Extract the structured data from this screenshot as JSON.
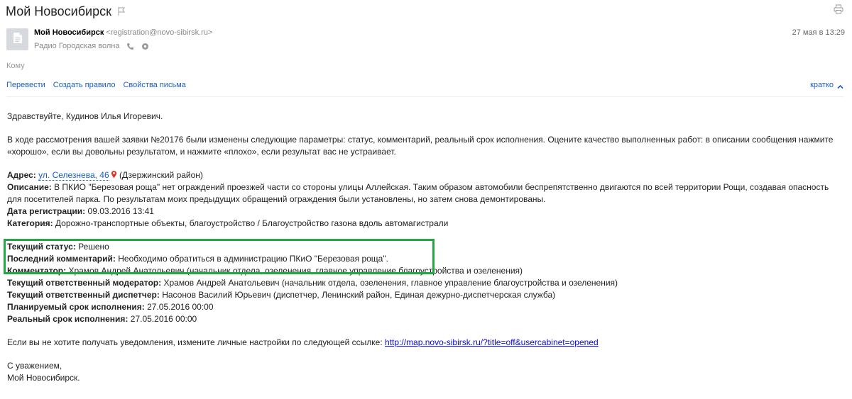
{
  "header": {
    "subject": "Мой Новосибирск"
  },
  "sender": {
    "name": "Мой Новосибирск",
    "email": "<registration@novo-sibirsk.ru>",
    "date": "27 мая в 13:29",
    "recipient": "Радио Городская волна"
  },
  "to_label": "Кому",
  "actions": {
    "translate": "Перевести",
    "create_rule": "Создать правило",
    "properties": "Свойства письма",
    "short": "кратко"
  },
  "body": {
    "greeting": "Здравствуйте, Кудинов Илья Игоревич.",
    "intro": "В ходе рассмотрения вашей заявки №20176 были изменены следующие параметры: статус, комментарий, реальный срок исполнения. Оцените качество выполненных работ: в описании сообщения нажмите «хорошо», если вы довольны результатом, и нажмите «плохо», если результат вас не устраивает.",
    "address_label": "Адрес:",
    "address_link": "ул. Селезнева, 46",
    "address_district": "(Дзержинский район)",
    "description_label": "Описание:",
    "description": "В ПКИО \"Березовая роща\" нет ограждений проезжей части со стороны улицы Аллейская. Таким образом автомобили беспрепятственно двигаются по всей территории Рощи, создавая опасность для посетителей парка. По результатам моих предыдущих обращений ограждения были установлены, но затем снова демонтированы.",
    "reg_date_label": "Дата регистрации:",
    "reg_date": "09.03.2016 13:41",
    "category_label": "Категория:",
    "category": "Дорожно-транспортные объекты, благоустройство / Благоустройство газона вдоль автомагистрали",
    "status_label": "Текущий статус:",
    "status": "Решено",
    "last_comment_label": "Последний комментарий:",
    "last_comment": "Необходимо обратиться в администрацию ПКиО \"Березовая роща\".",
    "commentator_label": "Комментатор:",
    "commentator": "Храмов Андрей Анатольевич (начальник отдела, озеленения, главное управление благоустройства и озеленения)",
    "moderator_label": "Текущий ответственный модератор:",
    "moderator": "Храмов Андрей Анатольевич (начальник отдела, озеленения, главное управление благоустройства и озеленения)",
    "dispatcher_label": "Текущий ответственный диспетчер:",
    "dispatcher": "Насонов Василий Юрьевич (диспетчер, Ленинский район, Единая дежурно-диспетчерская служба)",
    "planned_label": "Планируемый срок исполнения:",
    "planned": "27.05.2016 00:00",
    "real_label": "Реальный срок исполнения:",
    "real": "27.05.2016 00:00",
    "unsubscribe_text": "Если вы не хотите получать уведомления, измените личные настройки по следующей ссылке:",
    "unsubscribe_url": "http://map.novo-sibirsk.ru/?title=off&usercabinet=opened",
    "regards": "С уважением,",
    "signature": "Мой Новосибирск."
  },
  "colors": {
    "link": "#1a5ec2",
    "highlight": "#23a845",
    "avatar": "#d6d9dd"
  },
  "icons": [
    "flag-icon",
    "print-icon",
    "document-icon",
    "phone-icon",
    "settings-icon",
    "chevron-up-icon",
    "map-pin-icon"
  ]
}
